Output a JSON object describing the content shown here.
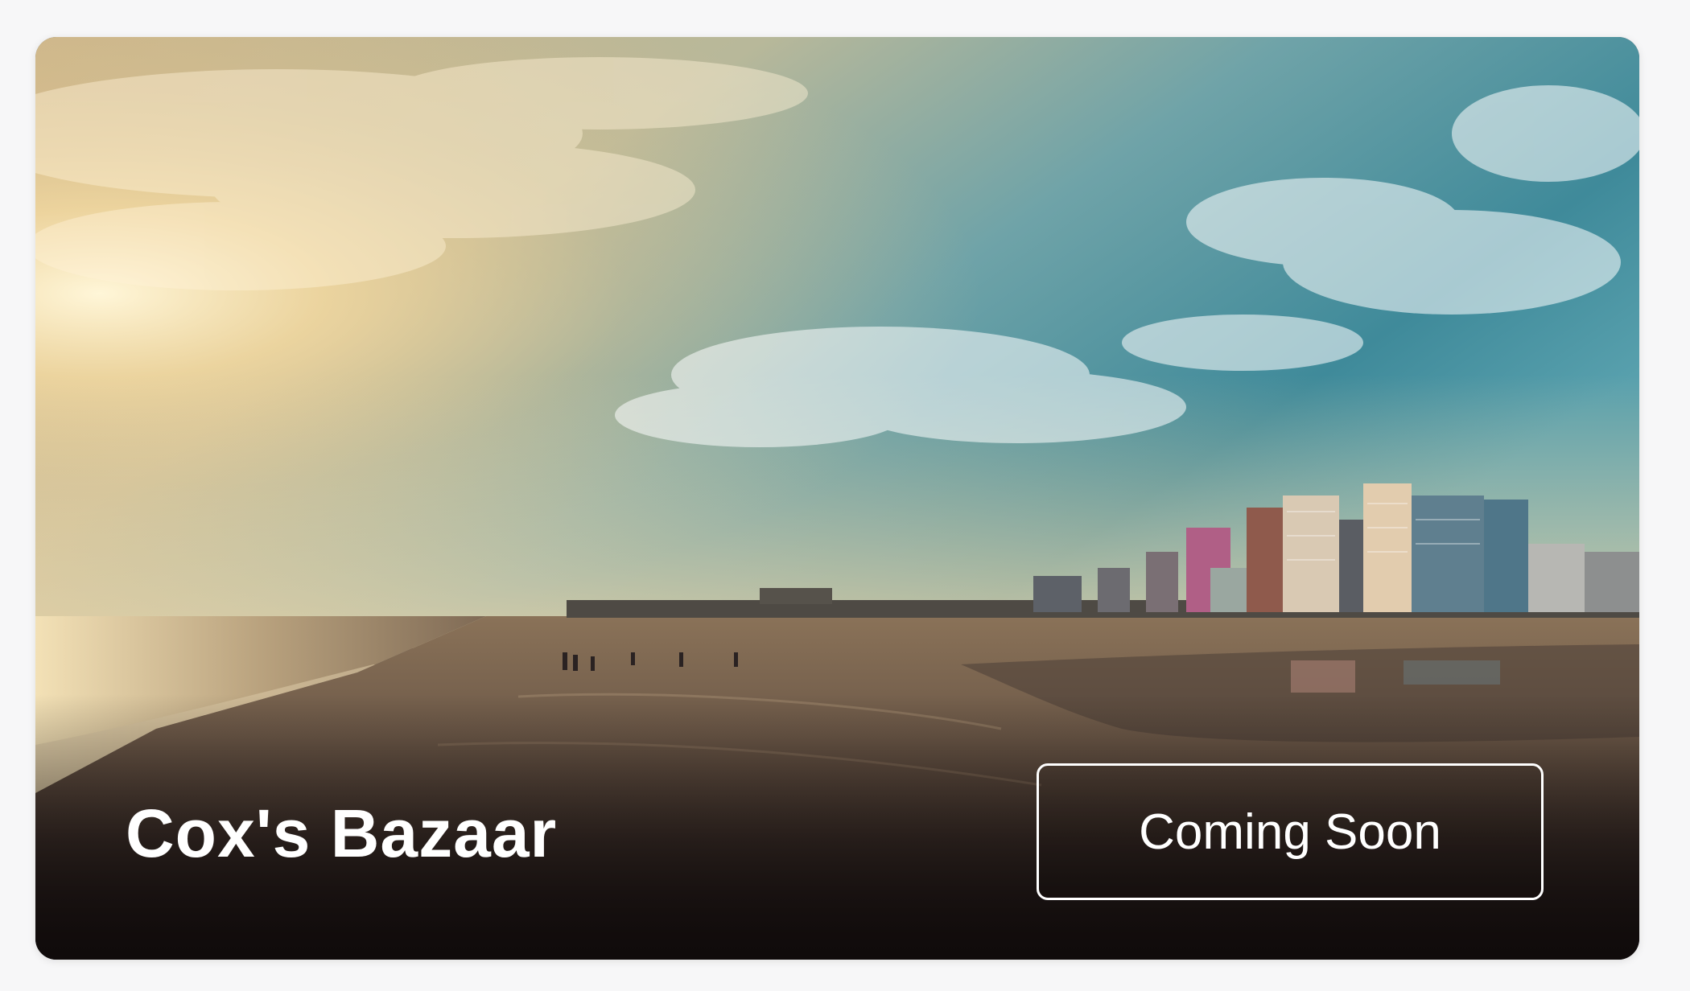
{
  "card": {
    "title": "Cox's Bazaar",
    "cta_label": "Coming Soon",
    "image_subject": "sunset-beach-with-hotels-photo"
  },
  "colors": {
    "page_background": "#f7f7f8",
    "text": "#ffffff",
    "button_border": "#ffffff"
  }
}
